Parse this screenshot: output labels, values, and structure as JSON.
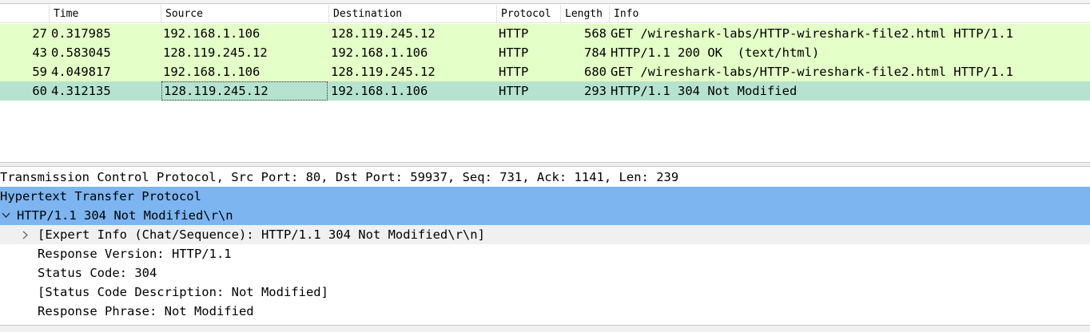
{
  "packet_list": {
    "columns": [
      "Time",
      "Source",
      "Destination",
      "Protocol",
      "Length",
      "Info"
    ],
    "rows": [
      {
        "no": "27",
        "time": "0.317985",
        "source": "192.168.1.106",
        "destination": "128.119.245.12",
        "protocol": "HTTP",
        "length": "568",
        "info": "GET /wireshark-labs/HTTP-wireshark-file2.html HTTP/1.1"
      },
      {
        "no": "43",
        "time": "0.583045",
        "source": "128.119.245.12",
        "destination": "192.168.1.106",
        "protocol": "HTTP",
        "length": "784",
        "info": "HTTP/1.1 200 OK  (text/html)"
      },
      {
        "no": "59",
        "time": "4.049817",
        "source": "192.168.1.106",
        "destination": "128.119.245.12",
        "protocol": "HTTP",
        "length": "680",
        "info": "GET /wireshark-labs/HTTP-wireshark-file2.html HTTP/1.1"
      },
      {
        "no": "60",
        "time": "4.312135",
        "source": "128.119.245.12",
        "destination": "192.168.1.106",
        "protocol": "HTTP",
        "length": "293",
        "info": "HTTP/1.1 304 Not Modified"
      }
    ],
    "colors": {
      "http_row": "#e4ffc7",
      "selected_row": "#b6e3cf"
    }
  },
  "details": {
    "lines": [
      "Transmission Control Protocol, Src Port: 80, Dst Port: 59937, Seq: 731, Ack: 1141, Len: 239",
      "Hypertext Transfer Protocol",
      "HTTP/1.1 304 Not Modified\\r\\n",
      "[Expert Info (Chat/Sequence): HTTP/1.1 304 Not Modified\\r\\n]",
      "Response Version: HTTP/1.1",
      "Status Code: 304",
      "[Status Code Description: Not Modified]",
      "Response Phrase: Not Modified"
    ],
    "colors": {
      "highlight": "#7db5f0",
      "hover": "#f0f0f0"
    }
  },
  "icons": {
    "expanded": "chevron-down-icon",
    "collapsed": "chevron-right-icon"
  }
}
